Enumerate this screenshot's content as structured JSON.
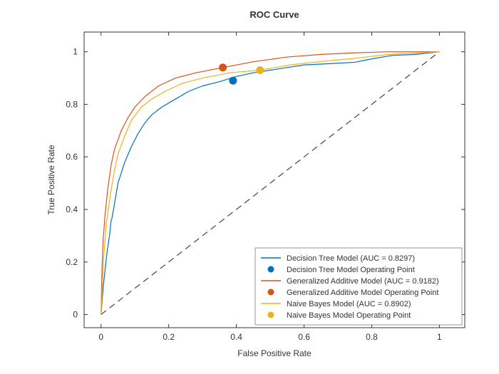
{
  "chart_data": {
    "type": "line",
    "title": "ROC Curve",
    "xlabel": "False Positive Rate",
    "ylabel": "True Positive Rate",
    "xlim": [
      -0.05,
      1.075
    ],
    "ylim": [
      -0.05,
      1.075
    ],
    "xticks": [
      0,
      0.2,
      0.4,
      0.6,
      0.8,
      1
    ],
    "yticks": [
      0,
      0.2,
      0.4,
      0.6,
      0.8,
      1
    ],
    "colors": {
      "dt": "#0072BD",
      "gam": "#D95319",
      "nb": "#EDB120",
      "diag": "#333333"
    },
    "series": [
      {
        "name": "dt",
        "label": "Decision Tree Model (AUC = 0.8297)",
        "x": [
          0,
          0.006,
          0.012,
          0.018,
          0.025,
          0.03,
          0.032,
          0.037,
          0.05,
          0.07,
          0.09,
          0.11,
          0.13,
          0.15,
          0.18,
          0.22,
          0.26,
          0.3,
          0.35,
          0.4,
          0.45,
          0.5,
          0.55,
          0.6,
          0.68,
          0.75,
          0.8,
          0.86,
          0.93,
          1.0
        ],
        "y": [
          0,
          0.1,
          0.17,
          0.24,
          0.3,
          0.36,
          0.365,
          0.4,
          0.5,
          0.58,
          0.64,
          0.69,
          0.73,
          0.76,
          0.79,
          0.82,
          0.85,
          0.87,
          0.886,
          0.906,
          0.92,
          0.93,
          0.94,
          0.95,
          0.955,
          0.96,
          0.973,
          0.986,
          0.99,
          1.0
        ]
      },
      {
        "name": "gam",
        "label": "Generalized Additive Model (AUC = 0.9182)",
        "x": [
          0,
          0.003,
          0.006,
          0.012,
          0.02,
          0.03,
          0.04,
          0.06,
          0.08,
          0.1,
          0.13,
          0.17,
          0.22,
          0.28,
          0.36,
          0.45,
          0.55,
          0.65,
          0.75,
          0.85,
          1.0
        ],
        "y": [
          0,
          0.18,
          0.28,
          0.38,
          0.48,
          0.57,
          0.63,
          0.7,
          0.75,
          0.79,
          0.83,
          0.87,
          0.9,
          0.92,
          0.94,
          0.962,
          0.98,
          0.99,
          0.996,
          1.0,
          1.0
        ]
      },
      {
        "name": "nb",
        "label": "Naive Bayes Model (AUC = 0.8902)",
        "x": [
          0,
          0.004,
          0.008,
          0.016,
          0.028,
          0.04,
          0.05,
          0.07,
          0.09,
          0.12,
          0.15,
          0.19,
          0.24,
          0.3,
          0.38,
          0.47,
          0.56,
          0.65,
          0.75,
          0.85,
          1.0
        ],
        "y": [
          0,
          0.12,
          0.22,
          0.35,
          0.46,
          0.55,
          0.61,
          0.68,
          0.74,
          0.79,
          0.82,
          0.85,
          0.88,
          0.9,
          0.92,
          0.93,
          0.95,
          0.963,
          0.975,
          0.99,
          1.0
        ]
      }
    ],
    "diagonal": {
      "x": [
        0,
        1
      ],
      "y": [
        0,
        1
      ]
    },
    "points": [
      {
        "name": "dt",
        "label": "Decision Tree Model Operating Point",
        "x": 0.39,
        "y": 0.89
      },
      {
        "name": "gam",
        "label": "Generalized Additive Model Operating Point",
        "x": 0.36,
        "y": 0.94
      },
      {
        "name": "nb",
        "label": "Naive Bayes Model Operating Point",
        "x": 0.47,
        "y": 0.93
      }
    ],
    "legend": [
      {
        "kind": "line",
        "color": "dt",
        "label": "Decision Tree Model (AUC = 0.8297)"
      },
      {
        "kind": "dot",
        "color": "dt",
        "label": "Decision Tree Model Operating Point"
      },
      {
        "kind": "line",
        "color": "gam",
        "label": "Generalized Additive Model (AUC = 0.9182)"
      },
      {
        "kind": "dot",
        "color": "gam",
        "label": "Generalized Additive Model Operating Point"
      },
      {
        "kind": "line",
        "color": "nb",
        "label": "Naive Bayes Model (AUC = 0.8902)"
      },
      {
        "kind": "dot",
        "color": "nb",
        "label": "Naive Bayes Model Operating Point"
      }
    ]
  }
}
